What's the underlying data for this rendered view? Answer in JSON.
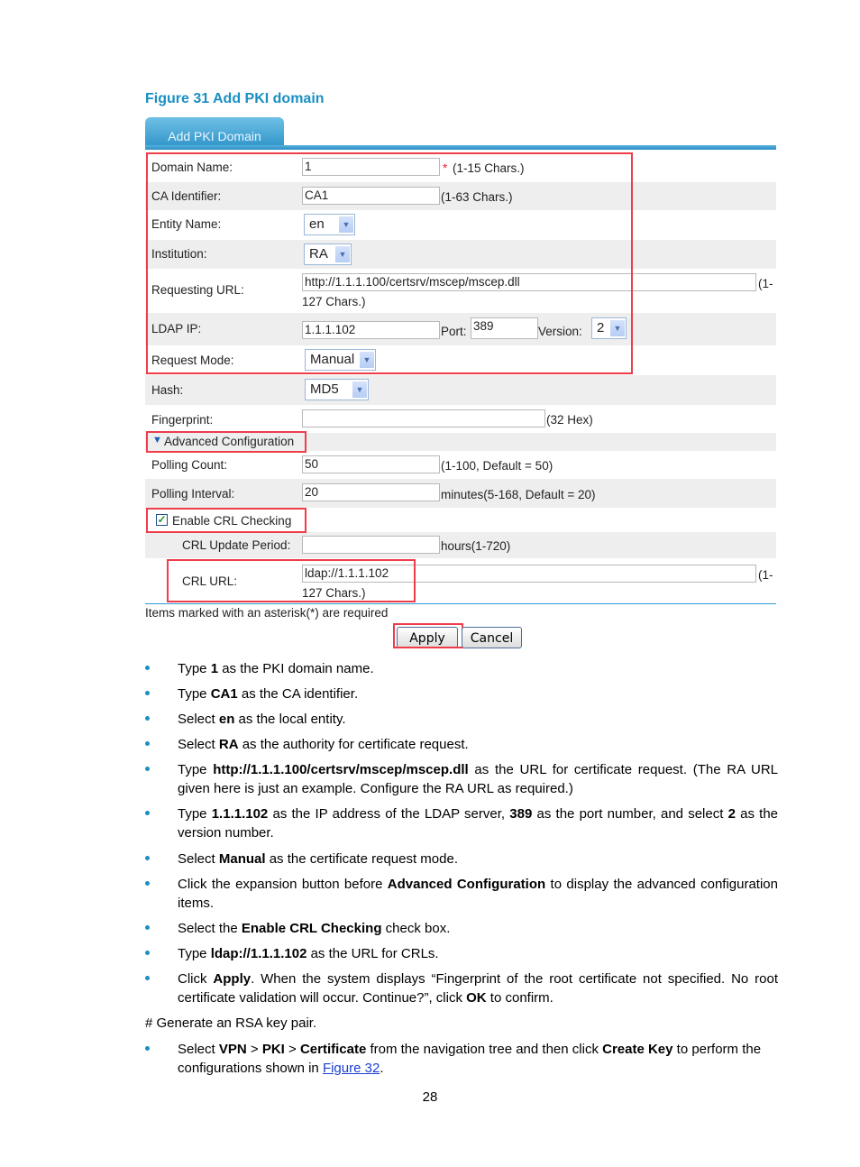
{
  "figure_title": "Figure 31 Add PKI domain",
  "form": {
    "tab_label": "Add PKI Domain",
    "domain_name": {
      "label": "Domain Name:",
      "value": "1",
      "required_mark": "*",
      "hint": "(1-15 Chars.)"
    },
    "ca_identifier": {
      "label": "CA Identifier:",
      "value": "CA1",
      "hint": "(1-63 Chars.)"
    },
    "entity_name": {
      "label": "Entity Name:",
      "selected": "en"
    },
    "institution": {
      "label": "Institution:",
      "selected": "RA"
    },
    "requesting_url": {
      "label": "Requesting URL:",
      "value": "http://1.1.1.100/certsrv/mscep/mscep.dll",
      "hint_part1": "(1-",
      "hint_part2": "127 Chars.)"
    },
    "ldap_ip": {
      "label": "LDAP IP:",
      "value": "1.1.1.102",
      "port_label": "Port:",
      "port_value": "389",
      "version_label": "Version:",
      "version_selected": "2"
    },
    "request_mode": {
      "label": "Request Mode:",
      "selected": "Manual"
    },
    "hash": {
      "label": "Hash:",
      "selected": "MD5"
    },
    "fingerprint": {
      "label": "Fingerprint:",
      "value": "",
      "hint": "(32 Hex)"
    },
    "advanced": {
      "label": "Advanced Configuration",
      "expanded": true
    },
    "polling_count": {
      "label": "Polling Count:",
      "value": "50",
      "hint": "(1-100, Default = 50)"
    },
    "polling_interval": {
      "label": "Polling Interval:",
      "value": "20",
      "hint": "minutes(5-168, Default = 20)"
    },
    "enable_crl": {
      "label": "Enable CRL Checking",
      "checked": true
    },
    "crl_update_period": {
      "label": "CRL Update Period:",
      "value": "",
      "hint": "hours(1-720)"
    },
    "crl_url": {
      "label": "CRL URL:",
      "value": "ldap://1.1.1.102",
      "hint_part1": "(1-",
      "hint_part2": "127 Chars.)"
    },
    "required_note": "Items marked with an asterisk(*) are required",
    "apply_label": "Apply",
    "cancel_label": "Cancel"
  },
  "steps": [
    {
      "parts": [
        {
          "t": "Type "
        },
        {
          "b": "1"
        },
        {
          "t": " as the PKI domain name."
        }
      ]
    },
    {
      "parts": [
        {
          "t": "Type "
        },
        {
          "b": "CA1"
        },
        {
          "t": " as the CA identifier."
        }
      ]
    },
    {
      "parts": [
        {
          "t": "Select "
        },
        {
          "b": "en"
        },
        {
          "t": " as the local entity."
        }
      ]
    },
    {
      "parts": [
        {
          "t": "Select "
        },
        {
          "b": "RA"
        },
        {
          "t": " as the authority for certificate request."
        }
      ]
    },
    {
      "parts": [
        {
          "t": "Type "
        },
        {
          "b": "http://1.1.1.100/certsrv/mscep/mscep.dll"
        },
        {
          "t": " as the URL for certificate request. (The RA URL given here is just an example. Configure the RA URL as required.)"
        }
      ]
    },
    {
      "parts": [
        {
          "t": "Type "
        },
        {
          "b": "1.1.1.102"
        },
        {
          "t": " as the IP address of the LDAP server, "
        },
        {
          "b": "389"
        },
        {
          "t": " as the port number, and select "
        },
        {
          "b": "2"
        },
        {
          "t": " as the version number."
        }
      ]
    },
    {
      "parts": [
        {
          "t": "Select "
        },
        {
          "b": "Manual"
        },
        {
          "t": " as the certificate request mode."
        }
      ]
    },
    {
      "parts": [
        {
          "t": "Click the expansion button before "
        },
        {
          "b": "Advanced Configuration"
        },
        {
          "t": " to display the advanced configuration items."
        }
      ]
    },
    {
      "parts": [
        {
          "t": "Select the "
        },
        {
          "b": "Enable CRL Checking"
        },
        {
          "t": " check box."
        }
      ]
    },
    {
      "parts": [
        {
          "t": "Type "
        },
        {
          "b": "ldap://1.1.1.102"
        },
        {
          "t": " as the URL for CRLs."
        }
      ]
    },
    {
      "parts": [
        {
          "t": "Click "
        },
        {
          "b": "Apply"
        },
        {
          "t": ". When the system displays “Fingerprint of the root certificate not specified. No root certificate validation will occur. Continue?”, click "
        },
        {
          "b": "OK"
        },
        {
          "t": " to confirm."
        }
      ]
    }
  ],
  "generate_heading": "# Generate an RSA key pair.",
  "final_step": {
    "parts": [
      {
        "t": "Select "
      },
      {
        "b": "VPN"
      },
      {
        "t": " > "
      },
      {
        "b": "PKI"
      },
      {
        "t": " > "
      },
      {
        "b": "Certificate"
      },
      {
        "t": " from the navigation tree and then click "
      },
      {
        "b": "Create Key"
      },
      {
        "t": " to perform the configurations shown in "
      },
      {
        "link": "Figure 32"
      },
      {
        "t": "."
      }
    ]
  },
  "page_number": "28",
  "colors": {
    "accent": "#1a8fc4",
    "highlight_box": "#ef3d4a",
    "link": "#1a3fd1"
  }
}
